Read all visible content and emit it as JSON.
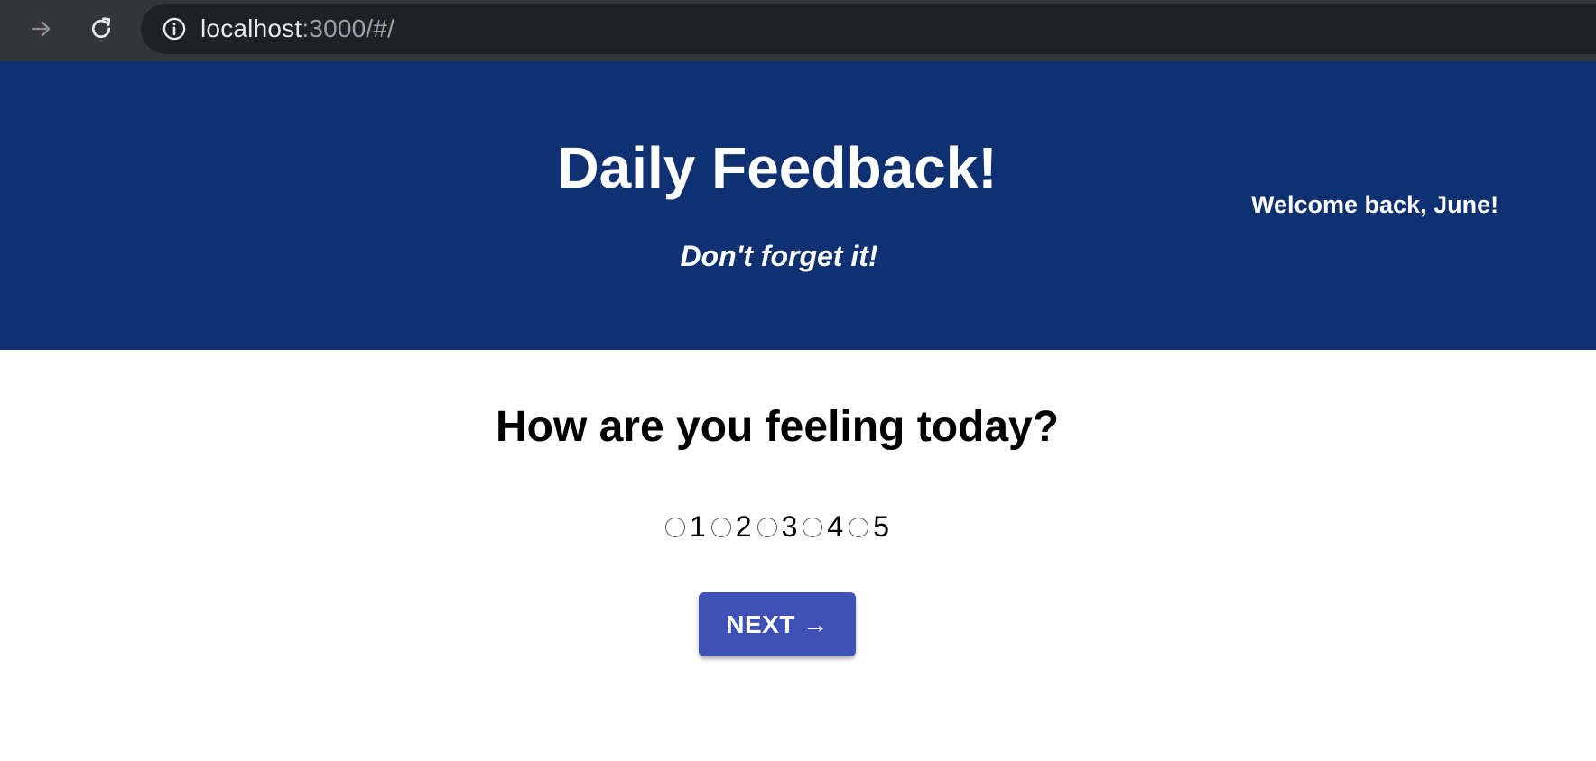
{
  "browser": {
    "url_host": "localhost",
    "url_rest": ":3000/#/",
    "icons": {
      "forward": "arrow-right-icon",
      "reload": "reload-icon",
      "info": "info-icon"
    }
  },
  "header": {
    "title": "Daily Feedback!",
    "subtitle": "Don't forget it!",
    "welcome": "Welcome back, June!",
    "background_color": "#0f3172"
  },
  "main": {
    "question": "How are you feeling today?",
    "rating_options": [
      "1",
      "2",
      "3",
      "4",
      "5"
    ],
    "next_button_label": "NEXT →",
    "next_button_color": "#3f51b5"
  }
}
